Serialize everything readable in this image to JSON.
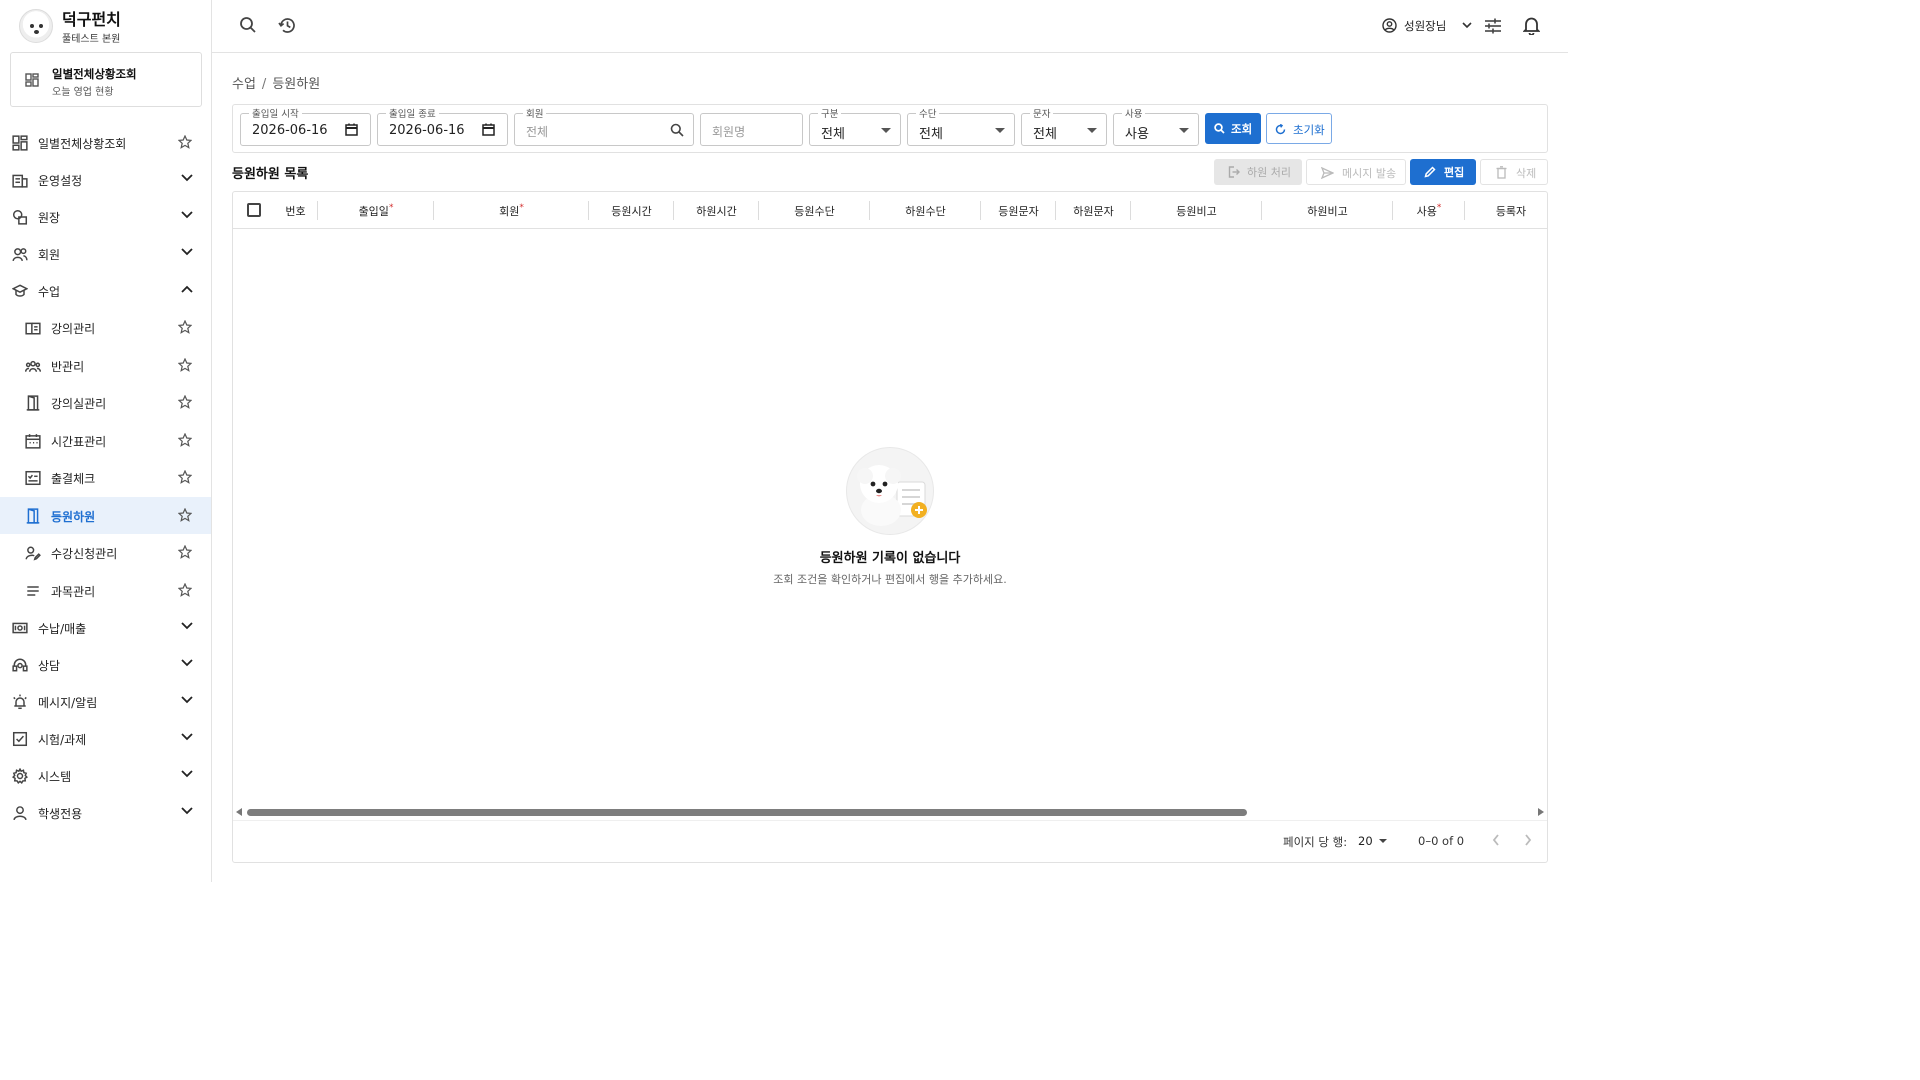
{
  "brand": {
    "title": "덕구펀치",
    "subtitle": "풀테스트 본원"
  },
  "dashboard_card": {
    "title": "일별전체상황조회",
    "subtitle": "오늘 영업 현황"
  },
  "sidebar": {
    "items": [
      {
        "label": "일별전체상황조회",
        "icon": "dashboard-icon",
        "trailing": "star"
      },
      {
        "label": "운영설정",
        "icon": "building-icon",
        "trailing": "chevron-down"
      },
      {
        "label": "원장",
        "icon": "shapes-icon",
        "trailing": "chevron-down"
      },
      {
        "label": "회원",
        "icon": "people-icon",
        "trailing": "chevron-down"
      },
      {
        "label": "수업",
        "icon": "graduation-cap-icon",
        "trailing": "chevron-up"
      },
      {
        "label": "강의관리",
        "icon": "book-icon",
        "trailing": "star",
        "sub": true
      },
      {
        "label": "반관리",
        "icon": "group-icon",
        "trailing": "star",
        "sub": true
      },
      {
        "label": "강의실관리",
        "icon": "door-icon",
        "trailing": "star",
        "sub": true
      },
      {
        "label": "시간표관리",
        "icon": "calendar-icon",
        "trailing": "star",
        "sub": true
      },
      {
        "label": "출결체크",
        "icon": "checklist-icon",
        "trailing": "star",
        "sub": true
      },
      {
        "label": "등원하원",
        "icon": "door-open-icon",
        "trailing": "star",
        "sub": true,
        "active": true
      },
      {
        "label": "수강신청관리",
        "icon": "person-edit-icon",
        "trailing": "star",
        "sub": true
      },
      {
        "label": "과목관리",
        "icon": "list-icon",
        "trailing": "star",
        "sub": true
      },
      {
        "label": "수납/매출",
        "icon": "money-icon",
        "trailing": "chevron-down"
      },
      {
        "label": "상담",
        "icon": "headset-icon",
        "trailing": "chevron-down"
      },
      {
        "label": "메시지/알림",
        "icon": "alarm-icon",
        "trailing": "chevron-down"
      },
      {
        "label": "시험/과제",
        "icon": "checkbox-icon",
        "trailing": "chevron-down"
      },
      {
        "label": "시스템",
        "icon": "gear-icon",
        "trailing": "chevron-down"
      },
      {
        "label": "학생전용",
        "icon": "person-icon",
        "trailing": "chevron-down"
      }
    ]
  },
  "topbar": {
    "user_name": "성원장님"
  },
  "breadcrumb": {
    "parent": "수업",
    "separator": "/",
    "current": "등원하원"
  },
  "filters": {
    "start": {
      "label": "출입일 시작",
      "value": "2026-06-16"
    },
    "end": {
      "label": "출입일 종료",
      "value": "2026-06-16"
    },
    "member": {
      "label": "회원",
      "placeholder": "전체"
    },
    "member_name": {
      "placeholder": "회원명"
    },
    "category": {
      "label": "구분",
      "value": "전체"
    },
    "method": {
      "label": "수단",
      "value": "전체"
    },
    "sms": {
      "label": "문자",
      "value": "전체"
    },
    "use": {
      "label": "사용",
      "value": "사용"
    },
    "search_button": "조회",
    "reset_button": "초기화"
  },
  "list": {
    "title": "등원하원 목록",
    "actions": {
      "checkout": "하원 처리",
      "message": "메시지 발송",
      "edit": "편집",
      "delete": "삭제"
    },
    "columns": [
      {
        "label": "번호",
        "required": false
      },
      {
        "label": "출입일",
        "required": true
      },
      {
        "label": "회원",
        "required": true
      },
      {
        "label": "등원시간",
        "required": false
      },
      {
        "label": "하원시간",
        "required": false
      },
      {
        "label": "등원수단",
        "required": false
      },
      {
        "label": "하원수단",
        "required": false
      },
      {
        "label": "등원문자",
        "required": false
      },
      {
        "label": "하원문자",
        "required": false
      },
      {
        "label": "등원비고",
        "required": false
      },
      {
        "label": "하원비고",
        "required": false
      },
      {
        "label": "사용",
        "required": true
      },
      {
        "label": "등록자",
        "required": false
      }
    ],
    "required_mark": "*",
    "empty_title": "등원하원 기록이 없습니다",
    "empty_subtitle": "조회 조건을 확인하거나 편집에서 행을 추가하세요."
  },
  "pagination": {
    "rows_label": "페이지 당 행:",
    "rows_per_page": "20",
    "range": "0–0 of 0"
  },
  "colors": {
    "primary": "#1e6fd0",
    "active_bg": "#e9f1fb",
    "required": "#d32f2f",
    "border": "#e1e1e1"
  }
}
